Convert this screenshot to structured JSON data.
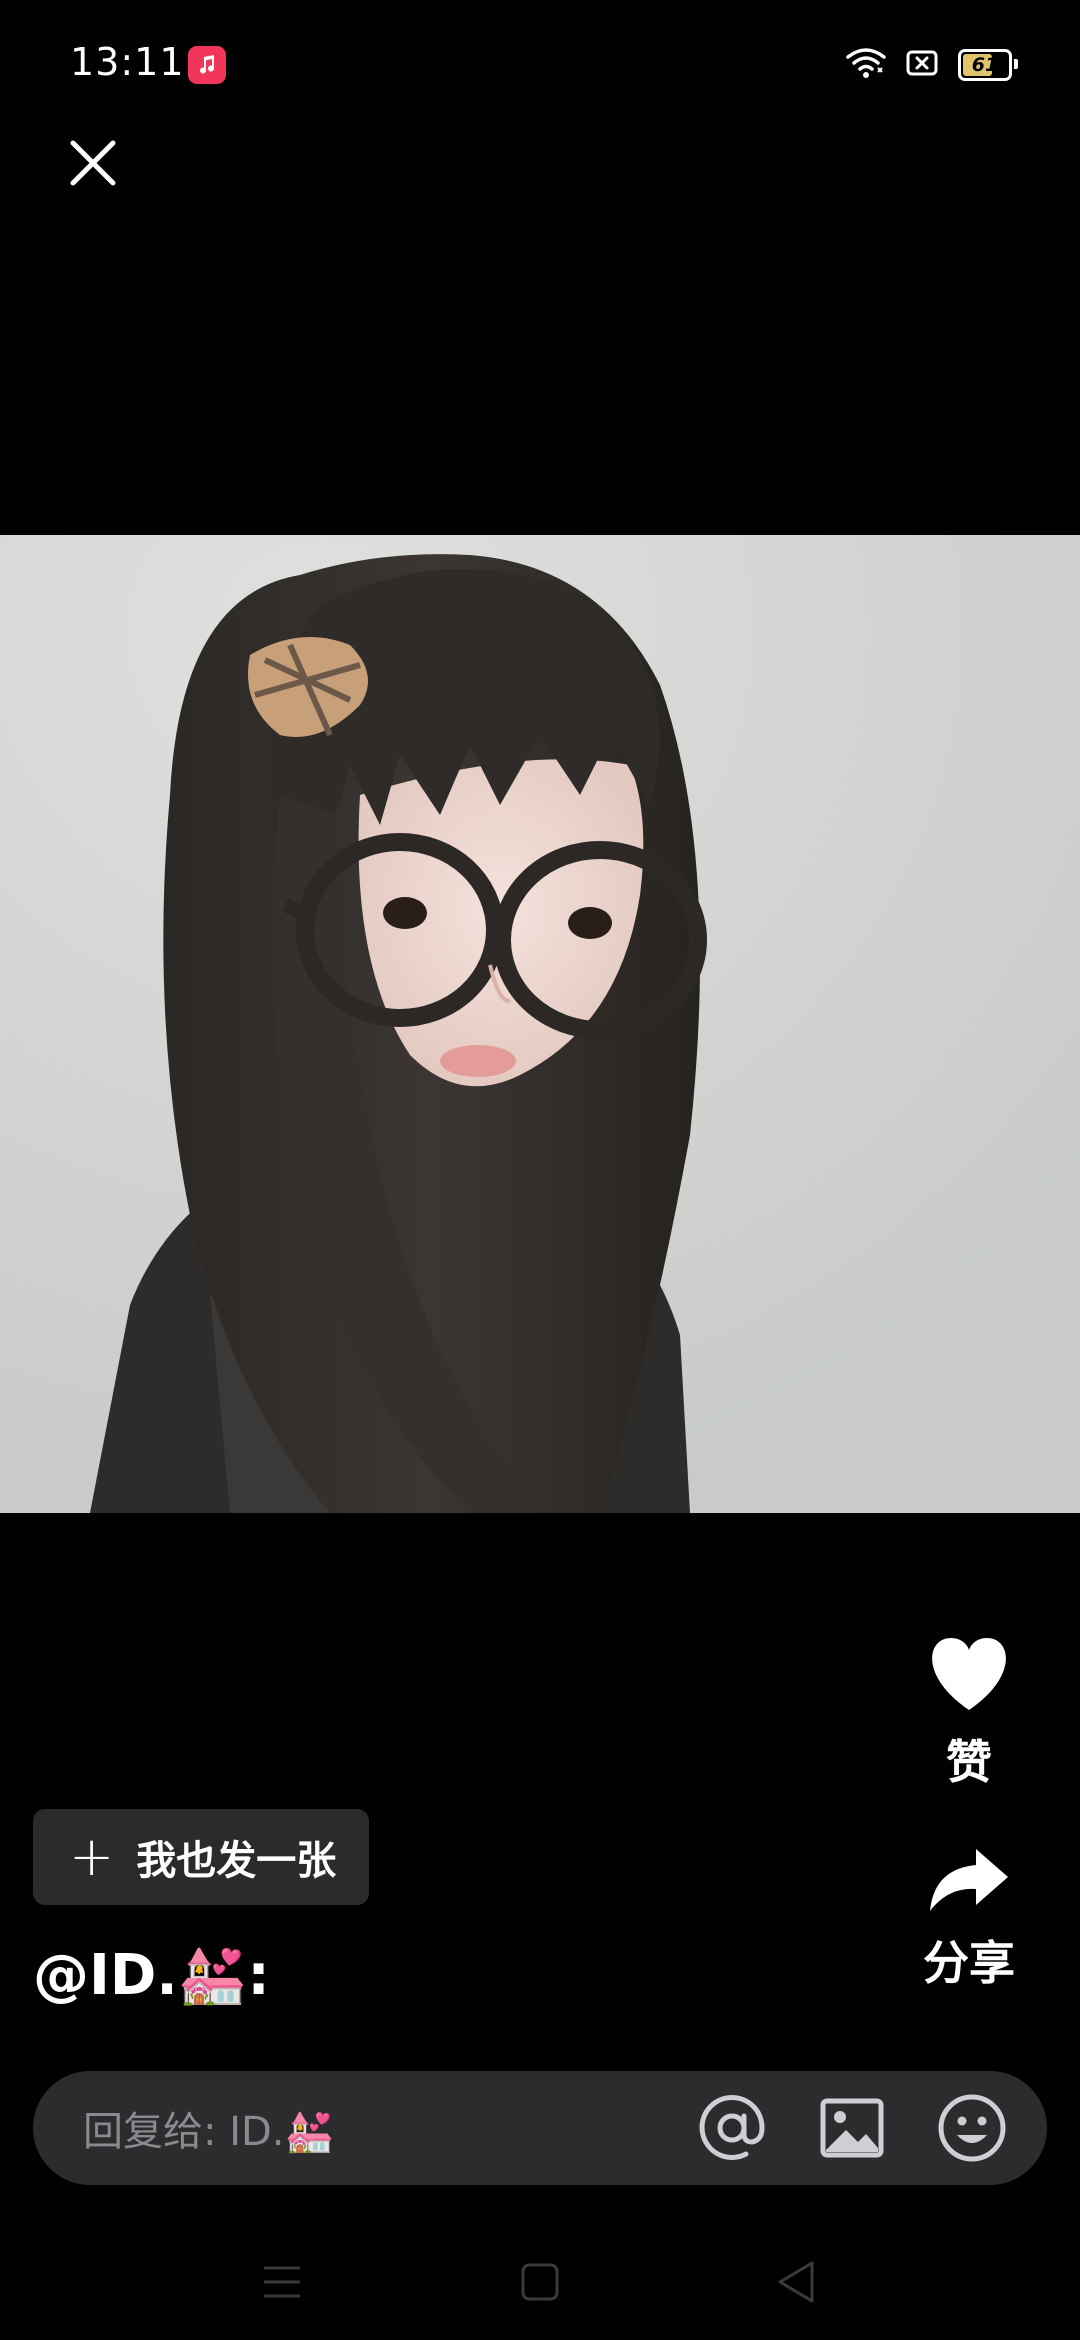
{
  "status_bar": {
    "time": "13:11",
    "battery_level": "61",
    "battery_fraction": 0.61,
    "app_icon": "music-icon",
    "icons": [
      "wifi-icon",
      "sim-icon",
      "battery-icon"
    ]
  },
  "header": {
    "close_icon": "close-icon"
  },
  "photo": {
    "subject": "photo-content"
  },
  "actions": {
    "like_label": "赞",
    "share_label": "分享"
  },
  "post": {
    "label": "我也发一张",
    "plus": "+"
  },
  "comment": {
    "handle": "@ID.💒:"
  },
  "reply": {
    "placeholder": "回复给: ID.💒",
    "icons": [
      "at-icon",
      "image-icon",
      "emoji-icon"
    ]
  },
  "nav": {
    "icons": [
      "menu-icon",
      "home-icon",
      "back-icon"
    ]
  },
  "colors": {
    "background": "#000000",
    "accent_badge": "#f2365a",
    "input_bg": "#2c2c2e",
    "button_bg": "#2b2b2b",
    "placeholder": "#8a8a8e"
  }
}
